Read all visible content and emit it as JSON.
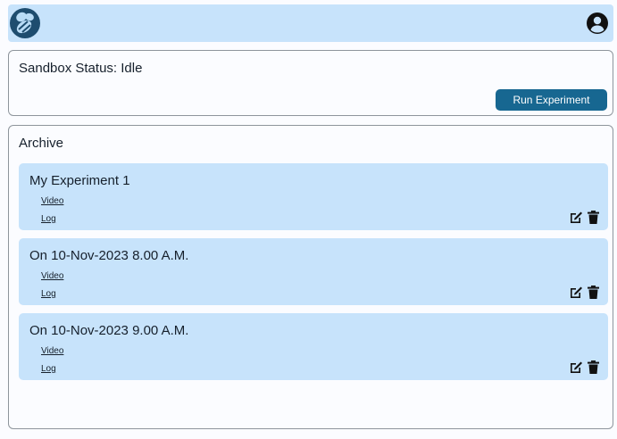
{
  "header": {
    "logo_icon": "bee-logo-icon",
    "account_icon": "user-circle-icon"
  },
  "status": {
    "text": "Sandbox Status: Idle",
    "run_button_label": "Run Experiment"
  },
  "archive": {
    "title": "Archive",
    "items": [
      {
        "title": "My Experiment 1",
        "video_label": "Video",
        "log_label": "Log"
      },
      {
        "title": "On 10-Nov-2023 8.00 A.M.",
        "video_label": "Video",
        "log_label": "Log"
      },
      {
        "title": "On 10-Nov-2023 9.00 A.M.",
        "video_label": "Video",
        "log_label": "Log"
      }
    ],
    "item_icons": [
      "edit-icon",
      "trash-icon"
    ]
  },
  "colors": {
    "header_bg": "#c7e3fb",
    "card_bg": "#c7e3fb",
    "accent_button": "#176791",
    "logo_bg": "#1e4d6f"
  }
}
